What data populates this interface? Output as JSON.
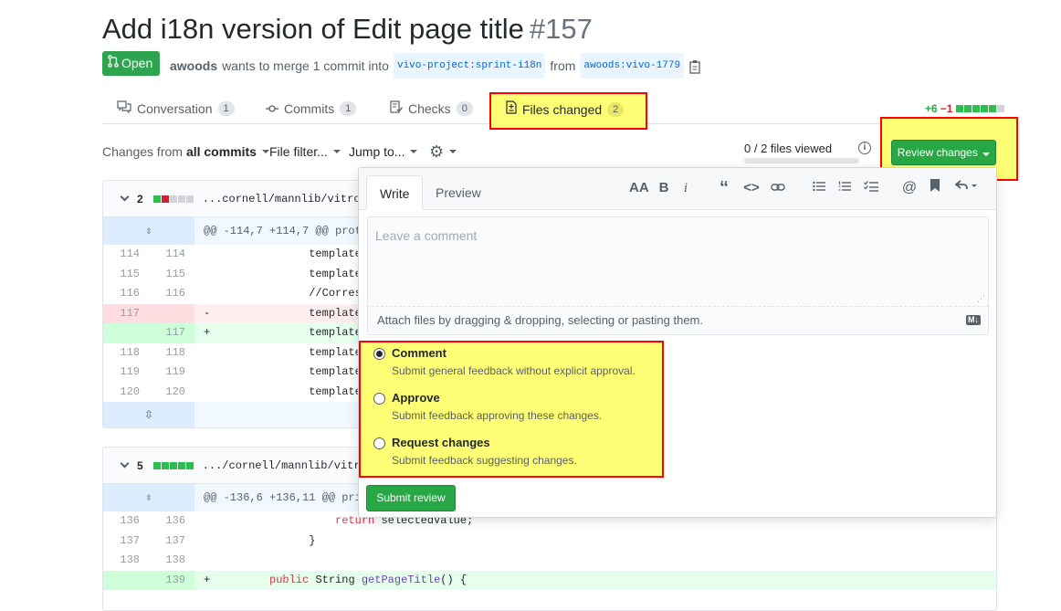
{
  "header": {
    "title": "Add i18n version of Edit page title",
    "number": "#157",
    "state": "Open",
    "author": "awoods",
    "merge_text": "wants to merge 1 commit into",
    "base_branch": "vivo-project:sprint-i18n",
    "from_text": "from",
    "head_branch": "awoods:vivo-1779"
  },
  "tabs": [
    {
      "label": "Conversation",
      "count": "1"
    },
    {
      "label": "Commits",
      "count": "1"
    },
    {
      "label": "Checks",
      "count": "0"
    },
    {
      "label": "Files changed",
      "count": "2"
    }
  ],
  "diffstat": {
    "additions": "+6",
    "deletions": "−1"
  },
  "toolbar": {
    "changes_from_prefix": "Changes from",
    "changes_from_value": "all commits",
    "file_filter": "File filter...",
    "jump_to": "Jump to...",
    "files_viewed": "0 / 2 files viewed",
    "review_button": "Review changes"
  },
  "file1": {
    "count": "2",
    "path": "...cornell/mannlib/vitro",
    "hunk": "@@ -114,7 +114,7 @@ prot",
    "lines": [
      {
        "old": "114",
        "new": "114",
        "sign": " ",
        "code": "            templateData.",
        "type": "ctx"
      },
      {
        "old": "115",
        "new": "115",
        "sign": " ",
        "code": "            templateData.",
        "type": "ctx"
      },
      {
        "old": "116",
        "new": "116",
        "sign": " ",
        "code": "            //Correspondi",
        "type": "ctx"
      },
      {
        "old": "117",
        "new": "",
        "sign": "-",
        "code": "            templateData.",
        "type": "del"
      },
      {
        "old": "",
        "new": "117",
        "sign": "+",
        "code": "            templateData.",
        "type": "add"
      },
      {
        "old": "118",
        "new": "118",
        "sign": " ",
        "code": "            templateData.",
        "type": "ctx"
      },
      {
        "old": "119",
        "new": "119",
        "sign": " ",
        "code": "            templateData.",
        "type": "ctx"
      },
      {
        "old": "120",
        "new": "120",
        "sign": " ",
        "code": "            templateData.",
        "type": "ctx"
      }
    ]
  },
  "file2": {
    "count": "5",
    "path": ".../cornell/mannlib/vitr",
    "hunk": "@@ -136,6 +136,11 @@ pri",
    "lines": [
      {
        "old": "136",
        "new": "136",
        "sign": " ",
        "type": "ctx",
        "indent": "                ",
        "kw": "return",
        "rest": " selectedValue;",
        "fn": "",
        "tail": ""
      },
      {
        "old": "137",
        "new": "137",
        "sign": " ",
        "type": "ctx",
        "indent": "            }",
        "kw": "",
        "rest": "",
        "fn": "",
        "tail": ""
      },
      {
        "old": "138",
        "new": "138",
        "sign": " ",
        "type": "ctx",
        "indent": "",
        "kw": "",
        "rest": "",
        "fn": "",
        "tail": ""
      },
      {
        "old": "",
        "new": "139",
        "sign": "+",
        "type": "add",
        "indent": "      ",
        "kw": "public",
        "rest": " String ",
        "fn": "getPageTitle",
        "tail": "() {"
      }
    ]
  },
  "review": {
    "tab_write": "Write",
    "tab_preview": "Preview",
    "placeholder": "Leave a comment",
    "attach_text": "Attach files by dragging & dropping, selecting or pasting them.",
    "md_badge": "M↓",
    "options": [
      {
        "label": "Comment",
        "desc": "Submit general feedback without explicit approval.",
        "checked": true
      },
      {
        "label": "Approve",
        "desc": "Submit feedback approving these changes.",
        "checked": false
      },
      {
        "label": "Request changes",
        "desc": "Submit feedback suggesting changes.",
        "checked": false
      }
    ],
    "submit": "Submit review"
  },
  "icons": {
    "toolbar": [
      "text-size-icon",
      "bold-icon",
      "italic-icon",
      "quote-icon",
      "code-icon",
      "link-icon",
      "unordered-list-icon",
      "ordered-list-icon",
      "task-list-icon",
      "mention-icon",
      "bookmark-icon",
      "reply-icon"
    ]
  },
  "colors": {
    "accent_green": "#28a745",
    "highlight_yellow": "#ffff75",
    "highlight_red": "#ff0000"
  }
}
